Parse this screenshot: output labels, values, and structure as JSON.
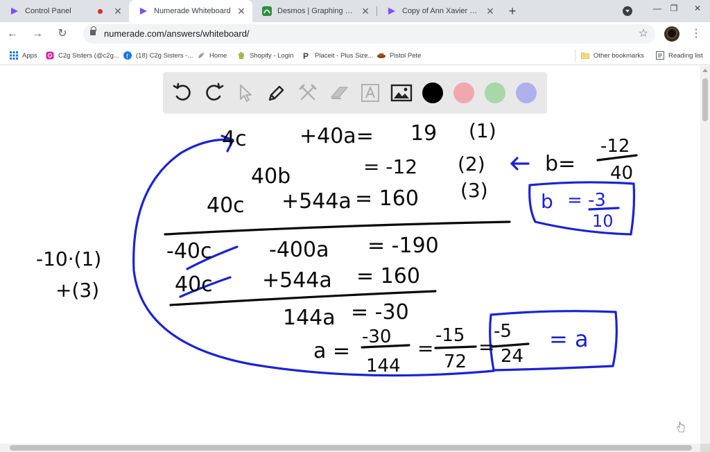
{
  "tabs": [
    {
      "title": "Control Panel",
      "recording": true
    },
    {
      "title": "Numerade Whiteboard",
      "active": true
    },
    {
      "title": "Desmos | Graphing Calculator"
    },
    {
      "title": "Copy of Ann Xavier Gantert - A"
    }
  ],
  "url": "numerade.com/answers/whiteboard/",
  "bookmarks": [
    {
      "label": "Apps",
      "icon": "apps-grid-icon"
    },
    {
      "label": "C2g Sisters (@c2g...",
      "icon": "instagram-icon"
    },
    {
      "label": "(18) C2g Sisters -...",
      "icon": "facebook-icon"
    },
    {
      "label": "Home",
      "icon": "home-leaf-icon"
    },
    {
      "label": "Shopify - Login",
      "icon": "shopify-icon"
    },
    {
      "label": "Placeit - Plus Size...",
      "icon": "placeit-icon"
    },
    {
      "label": "Pistol Pete",
      "icon": "pistol-pete-icon"
    }
  ],
  "other_bookmarks": "Other bookmarks",
  "reading_list": "Reading list",
  "whiteboard": {
    "tools": [
      "undo-icon",
      "redo-icon",
      "pointer-icon",
      "pen-icon",
      "tools-icon",
      "eraser-icon",
      "text-icon",
      "image-icon"
    ],
    "colors": [
      {
        "name": "black",
        "hex": "#000000"
      },
      {
        "name": "pink",
        "hex": "#f0a8ae"
      },
      {
        "name": "green",
        "hex": "#a8d8a8"
      },
      {
        "name": "purple",
        "hex": "#b0b0ee"
      }
    ],
    "ink_black": "#0a0a0a",
    "ink_blue": "#1a22d4",
    "handwriting": [
      "4c",
      "+40a=",
      "19",
      "(1)",
      "40b",
      "= -12",
      "(2)",
      "b=",
      "-12",
      "40",
      "40c",
      "+544a",
      "= 160",
      "(3)",
      "b",
      "= -3",
      "10",
      "-40c",
      "-400a",
      "= -190",
      "40c",
      "+544a",
      "= 160",
      "-10·(1)",
      "+(3)",
      "144a",
      "= -30",
      "a =",
      "-30",
      "144",
      "=",
      "-15",
      "72",
      "=",
      "-5",
      "24",
      "= a"
    ]
  }
}
